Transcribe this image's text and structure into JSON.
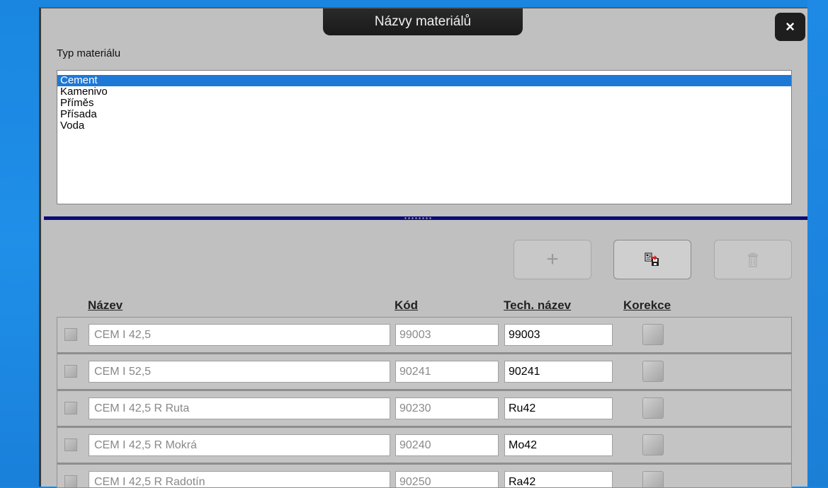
{
  "dialog": {
    "title": "Názvy materiálů",
    "close_label": "×"
  },
  "material_type": {
    "label": "Typ materiálu",
    "items": [
      "Cement",
      "Kamenivo",
      "Příměs",
      "Přísada",
      "Voda"
    ],
    "selected": "Cement"
  },
  "toolbar": {
    "add_label": "+",
    "save_icon": "save-icon",
    "delete_icon": "delete-icon"
  },
  "table": {
    "headers": {
      "name": "Název",
      "code": "Kód",
      "tech_name": "Tech. název",
      "correction": "Korekce"
    },
    "rows": [
      {
        "name": "CEM I 42,5",
        "code": "99003",
        "tech": "99003"
      },
      {
        "name": "CEM I 52,5",
        "code": "90241",
        "tech": "90241"
      },
      {
        "name": "CEM I 42,5 R Ruta",
        "code": "90230",
        "tech": "Ru42"
      },
      {
        "name": "CEM I 42,5 R Mokrá",
        "code": "90240",
        "tech": "Mo42"
      },
      {
        "name": "CEM I 42,5 R Radotín",
        "code": "90250",
        "tech": "Ra42"
      }
    ]
  },
  "colors": {
    "selection": "#1e78d6",
    "splitter": "#0a0a7a",
    "dialog_bg": "#c0c0c0",
    "desktop": "#1a86e0"
  }
}
